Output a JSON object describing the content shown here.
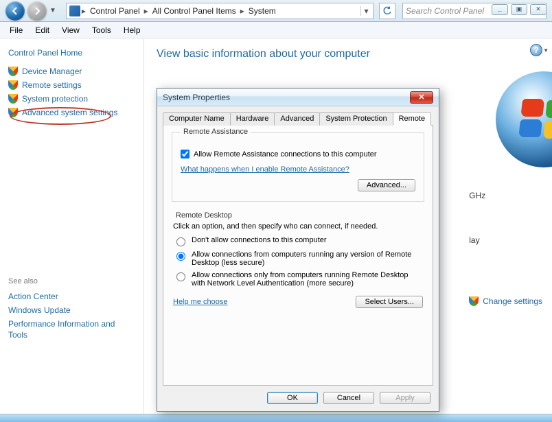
{
  "window_buttons": {
    "min": "_",
    "max": "▣",
    "close": "✕"
  },
  "breadcrumb": {
    "parts": [
      "Control Panel",
      "All Control Panel Items",
      "System"
    ],
    "search_placeholder": "Search Control Panel"
  },
  "menubar": [
    "File",
    "Edit",
    "View",
    "Tools",
    "Help"
  ],
  "sidebar": {
    "home": "Control Panel Home",
    "links": [
      "Device Manager",
      "Remote settings",
      "System protection",
      "Advanced system settings"
    ],
    "see_also_label": "See also",
    "see_also": [
      "Action Center",
      "Windows Update",
      "Performance Information and Tools"
    ]
  },
  "page": {
    "title": "View basic information about your computer",
    "right_ghz": "GHz",
    "right_play": "lay",
    "change_settings": "Change settings"
  },
  "dialog": {
    "title": "System Properties",
    "tabs": [
      "Computer Name",
      "Hardware",
      "Advanced",
      "System Protection",
      "Remote"
    ],
    "active_tab": 4,
    "remote_assistance": {
      "group_label": "Remote Assistance",
      "checkbox_label": "Allow Remote Assistance connections to this computer",
      "checkbox_checked": true,
      "help_link": "What happens when I enable Remote Assistance?",
      "advanced_btn": "Advanced..."
    },
    "remote_desktop": {
      "group_label": "Remote Desktop",
      "intro": "Click an option, and then specify who can connect, if needed.",
      "options": [
        "Don't allow connections to this computer",
        "Allow connections from computers running any version of Remote Desktop (less secure)",
        "Allow connections only from computers running Remote Desktop with Network Level Authentication (more secure)"
      ],
      "selected": 1,
      "help_link": "Help me choose",
      "select_users_btn": "Select Users..."
    },
    "buttons": {
      "ok": "OK",
      "cancel": "Cancel",
      "apply": "Apply"
    }
  }
}
